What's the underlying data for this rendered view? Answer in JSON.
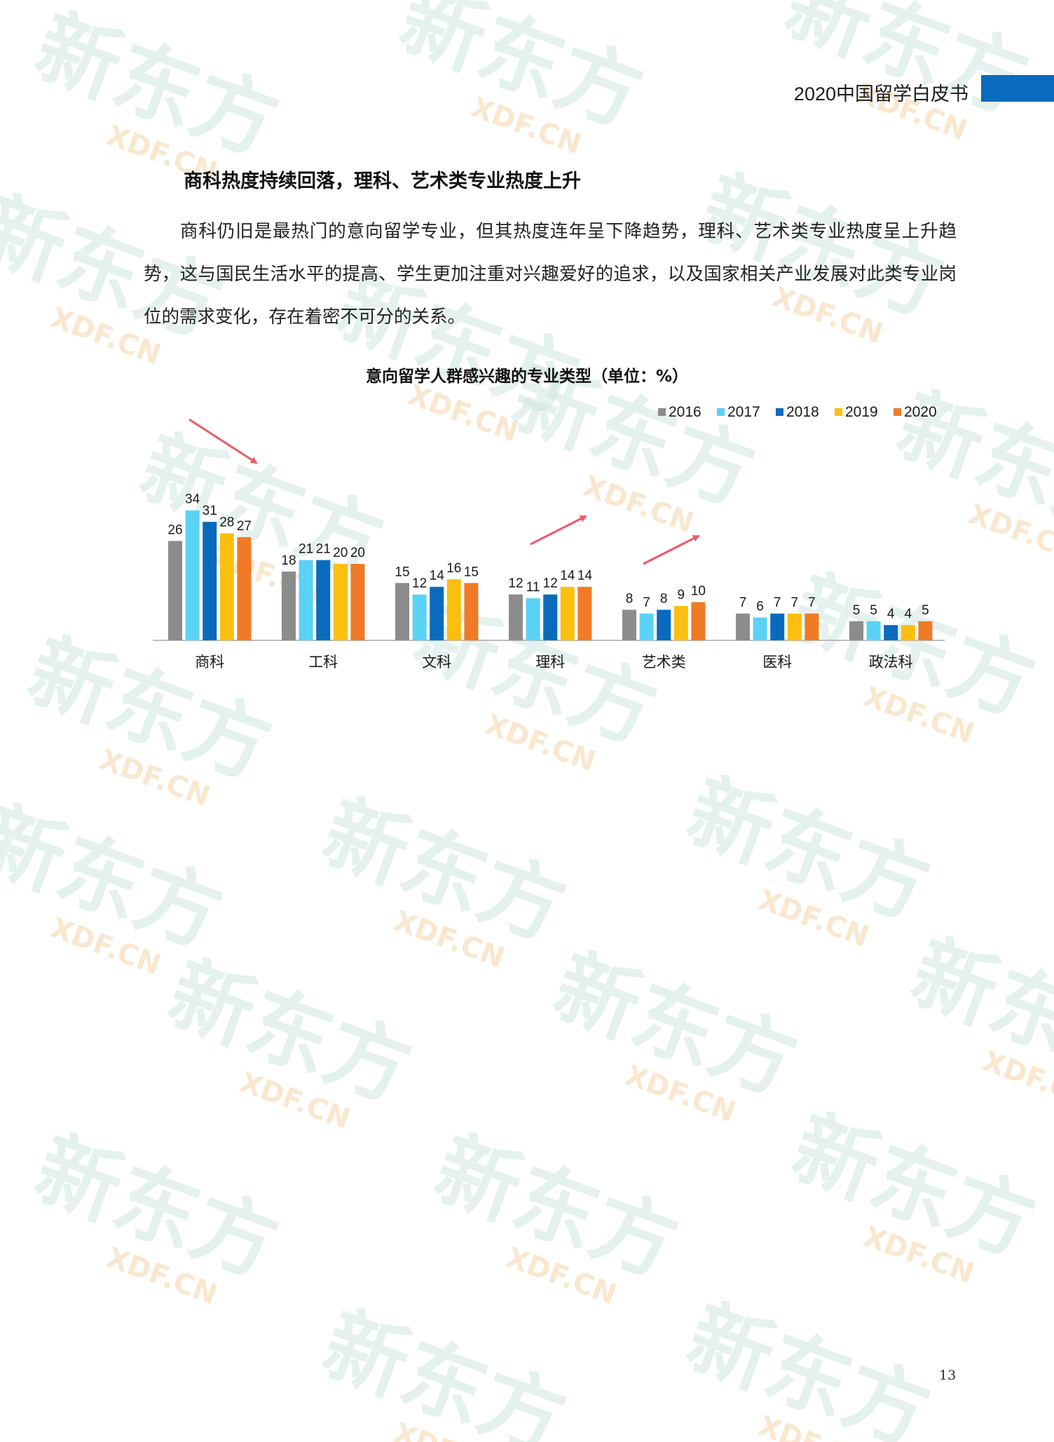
{
  "header": {
    "title": "2020中国留学白皮书",
    "accent_color": "#0a6bbd"
  },
  "section": {
    "heading": "商科热度持续回落，理科、艺术类专业热度上升",
    "paragraph": "商科仍旧是最热门的意向留学专业，但其热度连年呈下降趋势，理科、艺术类专业热度呈上升趋势，这与国民生活水平的提高、学生更加注重对兴趣爱好的追求，以及国家相关产业发展对此类专业岗位的需求变化，存在着密不可分的关系。"
  },
  "watermark": {
    "main": "新东方",
    "sub": "XDF.CN",
    "color": "#cfe6e1"
  },
  "chart_data": {
    "type": "bar",
    "title": "意向留学人群感兴趣的专业类型（单位：%）",
    "categories": [
      "商科",
      "工科",
      "文科",
      "理科",
      "艺术类",
      "医科",
      "政法科"
    ],
    "series": [
      {
        "name": "2016",
        "color": "#8c8c8c",
        "values": [
          26,
          18,
          15,
          12,
          8,
          7,
          5
        ]
      },
      {
        "name": "2017",
        "color": "#5ad2f5",
        "values": [
          34,
          21,
          12,
          11,
          7,
          6,
          5
        ]
      },
      {
        "name": "2018",
        "color": "#0a6bbd",
        "values": [
          31,
          21,
          14,
          12,
          8,
          7,
          4
        ]
      },
      {
        "name": "2019",
        "color": "#fbbf10",
        "values": [
          28,
          20,
          16,
          14,
          9,
          7,
          4
        ]
      },
      {
        "name": "2020",
        "color": "#f07a26",
        "values": [
          27,
          20,
          15,
          14,
          10,
          7,
          5
        ]
      }
    ],
    "legend_position": "top-right",
    "grid": false,
    "ylim": [
      0,
      40
    ],
    "xlabel": "",
    "ylabel": "",
    "trend_arrows": [
      {
        "category": "商科",
        "direction": "down",
        "color": "#ee5a66"
      },
      {
        "category": "理科",
        "direction": "up",
        "color": "#ee5a66"
      },
      {
        "category": "艺术类",
        "direction": "up",
        "color": "#ee5a66"
      }
    ]
  },
  "footer": {
    "page_number": "13"
  }
}
